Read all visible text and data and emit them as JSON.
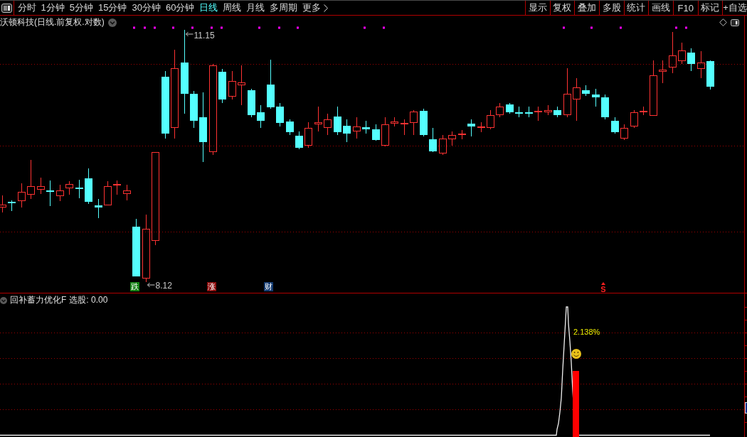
{
  "toolbar": {
    "period_tabs": [
      {
        "label": "分时",
        "selected": false,
        "kind": "tab"
      },
      {
        "label": "1分钟",
        "selected": false,
        "kind": "tab"
      },
      {
        "label": "5分钟",
        "selected": false,
        "kind": "tab"
      },
      {
        "label": "15分钟",
        "selected": false,
        "kind": "tab"
      },
      {
        "label": "30分钟",
        "selected": false,
        "kind": "tab"
      },
      {
        "label": "60分钟",
        "selected": false,
        "kind": "tab"
      },
      {
        "label": "日线",
        "selected": true,
        "kind": "tab"
      },
      {
        "label": "周线",
        "selected": false,
        "kind": "tab"
      },
      {
        "label": "月线",
        "selected": false,
        "kind": "tab"
      },
      {
        "label": "多周期",
        "selected": false,
        "kind": "tab"
      },
      {
        "label": "更多",
        "selected": false,
        "kind": "menu"
      }
    ],
    "tool_buttons": [
      "显示",
      "复权",
      "叠加",
      "多股",
      "统计",
      "画线",
      "F10",
      "标记",
      "+自选"
    ]
  },
  "main_chart": {
    "title": "沃顿科技(日线.前复权.对数)",
    "high_label": "11.15",
    "low_label": "8.12",
    "event_tags": [
      {
        "label": "跌",
        "color": "#128012"
      },
      {
        "label": "涨",
        "color": "#8a0c0c"
      },
      {
        "label": "财",
        "color": "#133a70"
      }
    ],
    "signal_label": "S"
  },
  "indicator": {
    "name": "回补蓄力优化F",
    "reading": "选股: 0.00",
    "annotation": "2.138%"
  }
}
